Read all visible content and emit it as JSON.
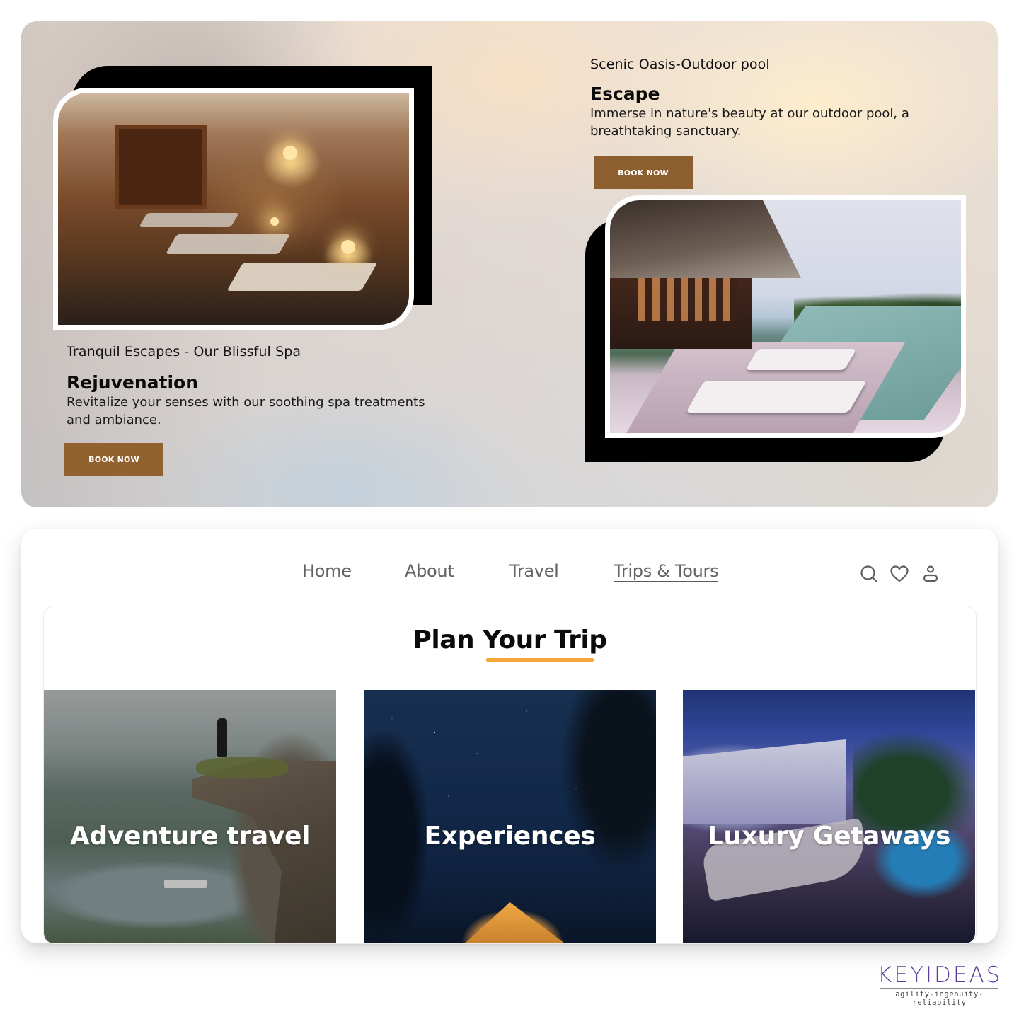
{
  "hero": {
    "spa": {
      "subtitle": "Tranquil Escapes - Our Blissful Spa",
      "heading": "Rejuvenation",
      "description": "Revitalize your senses with our soothing spa treatments and ambiance.",
      "button_label": "BOOK NOW",
      "image_alt": "Spa relaxation room with loungers and warm lamps"
    },
    "pool": {
      "subtitle": "Scenic Oasis-Outdoor pool",
      "heading": "Escape",
      "description": "Immerse in nature's beauty at our outdoor pool, a breathtaking sanctuary.",
      "button_label": "BOOK NOW",
      "image_alt": "Villa with infinity pool overlooking the ocean"
    },
    "colors": {
      "button": "#8c5e30"
    }
  },
  "nav": {
    "items": [
      {
        "label": "Home",
        "active": false
      },
      {
        "label": "About",
        "active": false
      },
      {
        "label": "Travel",
        "active": false
      },
      {
        "label": "Trips & Tours",
        "active": true
      }
    ],
    "icons": [
      "search-icon",
      "heart-icon",
      "user-icon"
    ]
  },
  "plan": {
    "title": "Plan Your Trip",
    "accent_color": "#f5a93a",
    "cards": [
      {
        "label": "Adventure travel",
        "image_alt": "Hiker on cliff over fjord"
      },
      {
        "label": "Experiences",
        "image_alt": "Tent under starry night sky"
      },
      {
        "label": "Luxury Getaways",
        "image_alt": "Luxury resort lounge at night"
      }
    ]
  },
  "logo": {
    "brand": "KEYIDEAS",
    "tagline": "agility-ingenuity-reliability",
    "color": "#5a3c9c"
  }
}
